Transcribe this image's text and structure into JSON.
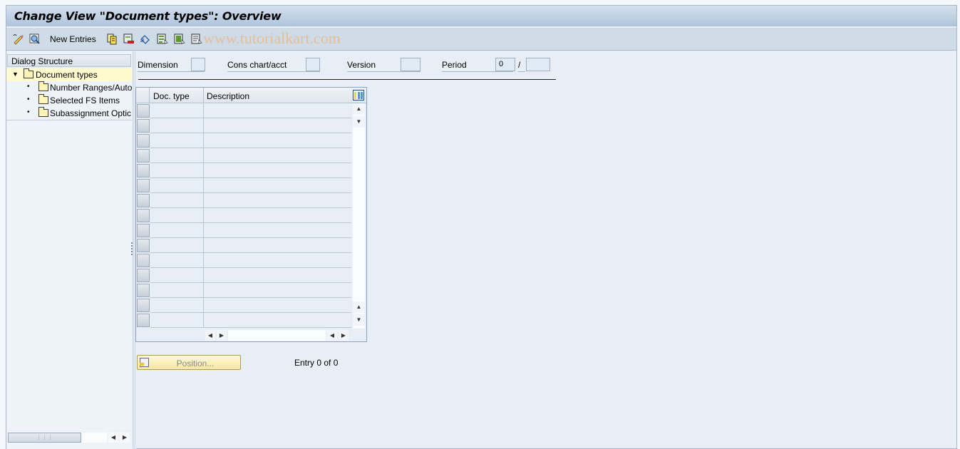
{
  "window": {
    "title": "Change View \"Document types\": Overview",
    "watermark": "www.tutorialkart.com"
  },
  "toolbar": {
    "items": [
      {
        "icon": "display-change-icon",
        "tooltip": ""
      },
      {
        "icon": "find-icon",
        "tooltip": ""
      },
      {
        "label": "New Entries"
      },
      {
        "icon": "copy-as-icon"
      },
      {
        "icon": "delete-icon"
      },
      {
        "icon": "undo-change-icon"
      },
      {
        "icon": "select-all-icon"
      },
      {
        "icon": "select-block-icon"
      },
      {
        "icon": "deselect-all-icon"
      }
    ],
    "new_entries_label": "New Entries"
  },
  "dialog_structure": {
    "header": "Dialog Structure",
    "items": [
      {
        "label": "Document types",
        "selected": true,
        "expanded": true,
        "level": 0
      },
      {
        "label": "Number Ranges/Auto",
        "selected": false,
        "level": 1
      },
      {
        "label": "Selected FS Items",
        "selected": false,
        "level": 1
      },
      {
        "label": "Subassignment Optic",
        "selected": false,
        "level": 1
      }
    ]
  },
  "header_fields": {
    "dimension": {
      "label": "Dimension",
      "value": ""
    },
    "cons_chart": {
      "label": "Cons chart/acct",
      "value": ""
    },
    "version": {
      "label": "Version",
      "value": ""
    },
    "period": {
      "label": "Period",
      "value": "0",
      "separator": "/",
      "year": ""
    }
  },
  "table": {
    "columns": [
      "Doc. type",
      "Description"
    ],
    "rows": [
      [
        "",
        ""
      ],
      [
        "",
        ""
      ],
      [
        "",
        ""
      ],
      [
        "",
        ""
      ],
      [
        "",
        ""
      ],
      [
        "",
        ""
      ],
      [
        "",
        ""
      ],
      [
        "",
        ""
      ],
      [
        "",
        ""
      ],
      [
        "",
        ""
      ],
      [
        "",
        ""
      ],
      [
        "",
        ""
      ],
      [
        "",
        ""
      ],
      [
        "",
        ""
      ],
      [
        "",
        ""
      ]
    ]
  },
  "footer": {
    "position_button": "Position...",
    "entry_text": "Entry 0 of 0"
  },
  "colors": {
    "title_gradient_top": "#d4e1ee",
    "title_gradient_bottom": "#aec4dc",
    "toolbar_bg": "#cfdce7",
    "selected_tree_bg": "#fffbcf",
    "position_button_bg": "#f7e7a3"
  }
}
